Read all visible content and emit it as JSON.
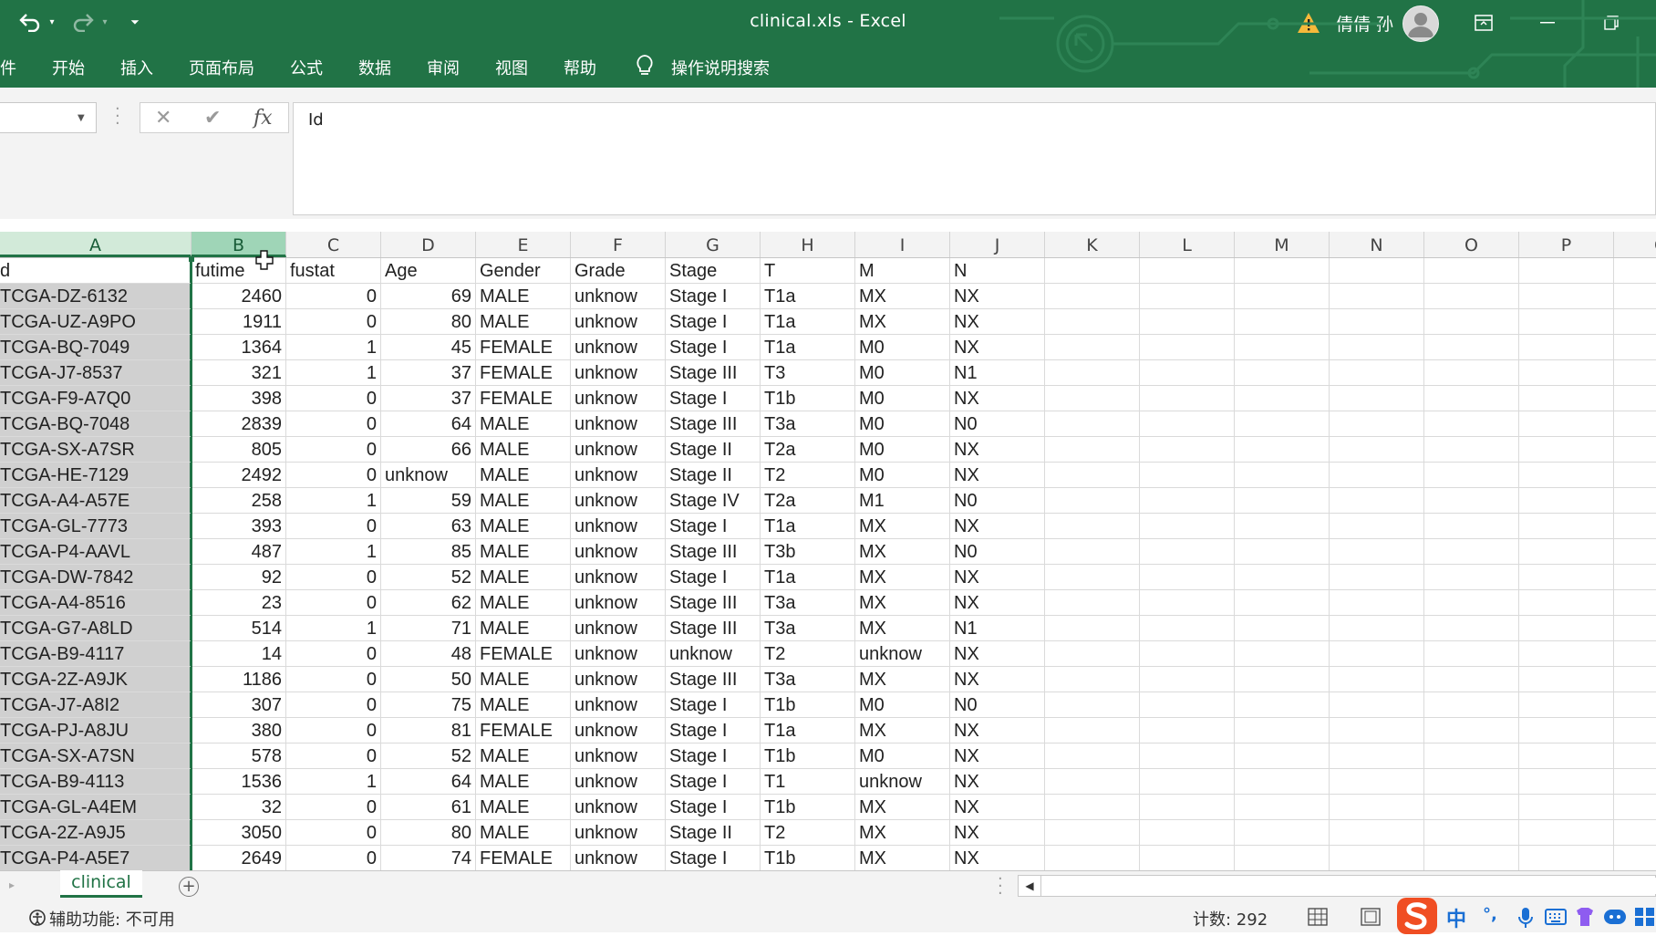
{
  "titlebar": {
    "doc_title": "clinical.xls  -  Excel",
    "user_name": "倩倩 孙"
  },
  "ribbon": {
    "tabs": [
      "件",
      "开始",
      "插入",
      "页面布局",
      "公式",
      "数据",
      "审阅",
      "视图",
      "帮助"
    ],
    "search_label": "操作说明搜索"
  },
  "formula_bar": {
    "name_box": "",
    "formula": "Id"
  },
  "grid": {
    "columns": [
      "A",
      "B",
      "C",
      "D",
      "E",
      "F",
      "G",
      "H",
      "I",
      "J",
      "K",
      "L",
      "M",
      "N",
      "O",
      "P",
      "Q"
    ],
    "header_row": [
      "d",
      "futime",
      "fustat",
      "Age",
      "Gender",
      "Grade",
      "Stage",
      "T",
      "M",
      "N"
    ],
    "rows": [
      [
        "TCGA-DZ-6132",
        "2460",
        "0",
        "69",
        "MALE",
        "unknow",
        "Stage I",
        "T1a",
        "MX",
        "NX"
      ],
      [
        "TCGA-UZ-A9PO",
        "1911",
        "0",
        "80",
        "MALE",
        "unknow",
        "Stage I",
        "T1a",
        "MX",
        "NX"
      ],
      [
        "TCGA-BQ-7049",
        "1364",
        "1",
        "45",
        "FEMALE",
        "unknow",
        "Stage I",
        "T1a",
        "M0",
        "NX"
      ],
      [
        "TCGA-J7-8537",
        "321",
        "1",
        "37",
        "FEMALE",
        "unknow",
        "Stage III",
        "T3",
        "M0",
        "N1"
      ],
      [
        "TCGA-F9-A7Q0",
        "398",
        "0",
        "37",
        "FEMALE",
        "unknow",
        "Stage I",
        "T1b",
        "M0",
        "NX"
      ],
      [
        "TCGA-BQ-7048",
        "2839",
        "0",
        "64",
        "MALE",
        "unknow",
        "Stage III",
        "T3a",
        "M0",
        "N0"
      ],
      [
        "TCGA-SX-A7SR",
        "805",
        "0",
        "66",
        "MALE",
        "unknow",
        "Stage II",
        "T2a",
        "M0",
        "NX"
      ],
      [
        "TCGA-HE-7129",
        "2492",
        "0",
        "unknow",
        "MALE",
        "unknow",
        "Stage II",
        "T2",
        "M0",
        "NX"
      ],
      [
        "TCGA-A4-A57E",
        "258",
        "1",
        "59",
        "MALE",
        "unknow",
        "Stage IV",
        "T2a",
        "M1",
        "N0"
      ],
      [
        "TCGA-GL-7773",
        "393",
        "0",
        "63",
        "MALE",
        "unknow",
        "Stage I",
        "T1a",
        "MX",
        "NX"
      ],
      [
        "TCGA-P4-AAVL",
        "487",
        "1",
        "85",
        "MALE",
        "unknow",
        "Stage III",
        "T3b",
        "MX",
        "N0"
      ],
      [
        "TCGA-DW-7842",
        "92",
        "0",
        "52",
        "MALE",
        "unknow",
        "Stage I",
        "T1a",
        "MX",
        "NX"
      ],
      [
        "TCGA-A4-8516",
        "23",
        "0",
        "62",
        "MALE",
        "unknow",
        "Stage III",
        "T3a",
        "MX",
        "NX"
      ],
      [
        "TCGA-G7-A8LD",
        "514",
        "1",
        "71",
        "MALE",
        "unknow",
        "Stage III",
        "T3a",
        "MX",
        "N1"
      ],
      [
        "TCGA-B9-4117",
        "14",
        "0",
        "48",
        "FEMALE",
        "unknow",
        "unknow",
        "T2",
        "unknow",
        "NX"
      ],
      [
        "TCGA-2Z-A9JK",
        "1186",
        "0",
        "50",
        "MALE",
        "unknow",
        "Stage III",
        "T3a",
        "MX",
        "NX"
      ],
      [
        "TCGA-J7-A8I2",
        "307",
        "0",
        "75",
        "MALE",
        "unknow",
        "Stage I",
        "T1b",
        "M0",
        "N0"
      ],
      [
        "TCGA-PJ-A8JU",
        "380",
        "0",
        "81",
        "FEMALE",
        "unknow",
        "Stage I",
        "T1a",
        "MX",
        "NX"
      ],
      [
        "TCGA-SX-A7SN",
        "578",
        "0",
        "52",
        "MALE",
        "unknow",
        "Stage I",
        "T1b",
        "M0",
        "NX"
      ],
      [
        "TCGA-B9-4113",
        "1536",
        "1",
        "64",
        "MALE",
        "unknow",
        "Stage I",
        "T1",
        "unknow",
        "NX"
      ],
      [
        "TCGA-GL-A4EM",
        "32",
        "0",
        "61",
        "MALE",
        "unknow",
        "Stage I",
        "T1b",
        "MX",
        "NX"
      ],
      [
        "TCGA-2Z-A9J5",
        "3050",
        "0",
        "80",
        "MALE",
        "unknow",
        "Stage II",
        "T2",
        "MX",
        "NX"
      ],
      [
        "TCGA-P4-A5E7",
        "2649",
        "0",
        "74",
        "FEMALE",
        "unknow",
        "Stage I",
        "T1b",
        "MX",
        "NX"
      ]
    ]
  },
  "sheets": {
    "active_tab": "clinical"
  },
  "statusbar": {
    "accessibility": "辅助功能: 不可用",
    "count": "计数: 292"
  },
  "ime": {
    "mode": "中",
    "punct": "°,"
  },
  "colors": {
    "brand_green": "#217346",
    "selected_header": "#d2ead9",
    "active_header": "#9fd5b7",
    "selected_column_cells": "#d0d0d0"
  }
}
